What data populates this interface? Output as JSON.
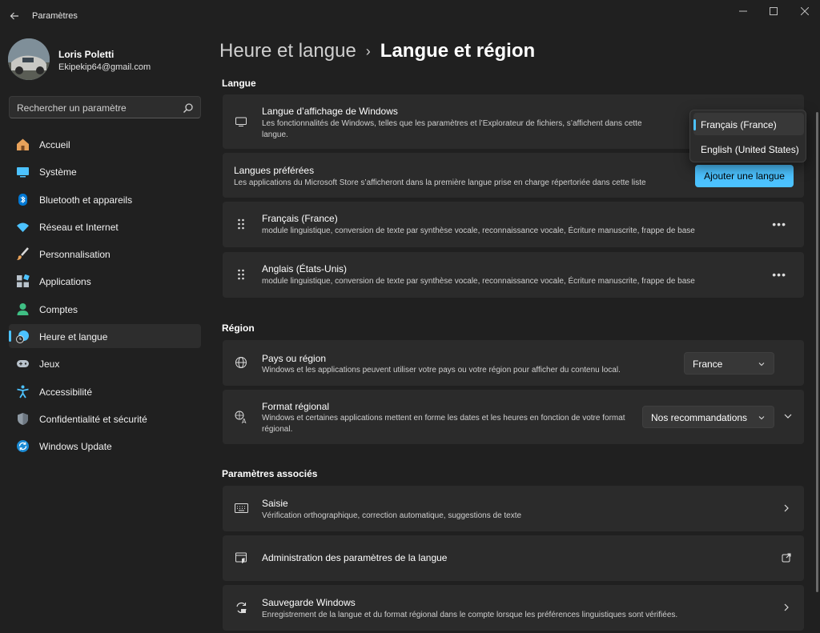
{
  "window": {
    "title": "Paramètres"
  },
  "profile": {
    "name": "Loris Poletti",
    "email": "Ekipekip64@gmail.com"
  },
  "search": {
    "placeholder": "Rechercher un paramètre"
  },
  "sidebar": {
    "items": [
      {
        "label": "Accueil",
        "icon": "home-icon"
      },
      {
        "label": "Système",
        "icon": "system-icon"
      },
      {
        "label": "Bluetooth et appareils",
        "icon": "bluetooth-icon"
      },
      {
        "label": "Réseau et Internet",
        "icon": "wifi-icon"
      },
      {
        "label": "Personnalisation",
        "icon": "brush-icon"
      },
      {
        "label": "Applications",
        "icon": "apps-icon"
      },
      {
        "label": "Comptes",
        "icon": "account-icon"
      },
      {
        "label": "Heure et langue",
        "icon": "time-language-icon",
        "active": true
      },
      {
        "label": "Jeux",
        "icon": "gamepad-icon"
      },
      {
        "label": "Accessibilité",
        "icon": "accessibility-icon"
      },
      {
        "label": "Confidentialité et sécurité",
        "icon": "shield-icon"
      },
      {
        "label": "Windows Update",
        "icon": "update-icon"
      }
    ]
  },
  "breadcrumb": {
    "parent": "Heure et langue",
    "separator": "›",
    "current": "Langue et région"
  },
  "langue": {
    "title": "Langue",
    "display": {
      "title": "Langue d’affichage de Windows",
      "desc": "Les fonctionnalités de Windows, telles que les paramètres et l’Explorateur de fichiers, s’affichent dans cette langue.",
      "options": [
        "Français (France)",
        "English (United States)"
      ],
      "selected": "Français (France)"
    },
    "preferred": {
      "title": "Langues préférées",
      "desc": "Les applications du Microsoft Store s’afficheront dans la première langue prise en charge répertoriée dans cette liste",
      "button": "Ajouter une langue"
    },
    "languages": [
      {
        "name": "Français (France)",
        "features": "module linguistique, conversion de texte par synthèse vocale, reconnaissance vocale, Écriture manuscrite, frappe de base"
      },
      {
        "name": "Anglais (États-Unis)",
        "features": "module linguistique, conversion de texte par synthèse vocale, reconnaissance vocale, Écriture manuscrite, frappe de base"
      }
    ],
    "more_label": "•••"
  },
  "region": {
    "title": "Région",
    "country": {
      "title": "Pays ou région",
      "desc": "Windows et les applications peuvent utiliser votre pays ou votre région pour afficher du contenu local.",
      "value": "France"
    },
    "format": {
      "title": "Format régional",
      "desc": "Windows et certaines applications mettent en forme les dates et les heures en fonction de votre format régional.",
      "value": "Nos recommandations"
    }
  },
  "related": {
    "title": "Paramètres associés",
    "items": [
      {
        "title": "Saisie",
        "desc": "Vérification orthographique, correction automatique, suggestions de texte",
        "icon": "keyboard-icon"
      },
      {
        "title": "Administration des paramètres de la langue",
        "desc": "",
        "icon": "admin-language-icon"
      },
      {
        "title": "Sauvegarde Windows",
        "desc": "Enregistrement de la langue et du format régional dans le compte lorsque les préférences linguistiques sont vérifiées.",
        "icon": "backup-icon"
      }
    ]
  },
  "colors": {
    "accent": "#4cc2ff",
    "background": "#202020",
    "card": "#2b2b2b"
  }
}
